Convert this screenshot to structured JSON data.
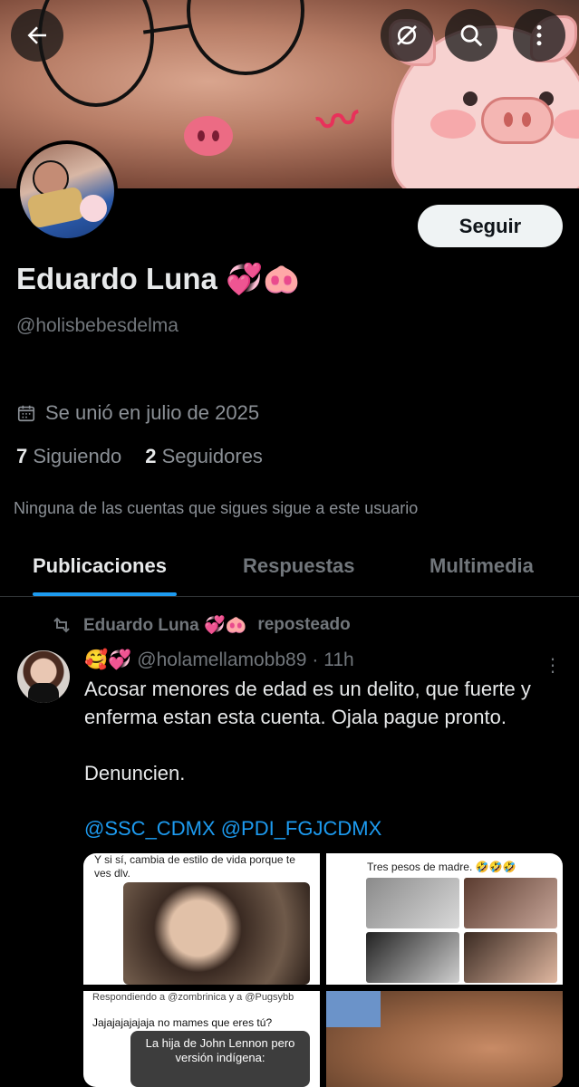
{
  "header": {
    "back_icon": "arrow-left-icon",
    "grok_icon": "grok-icon",
    "search_icon": "search-icon",
    "more_icon": "more-vertical-icon"
  },
  "profile": {
    "follow_label": "Seguir",
    "name": "Eduardo Luna 💞🐽",
    "handle": "@holisbebesdelma",
    "joined": "Se unió en julio de 2025",
    "following_count": "7",
    "following_label": "Siguiendo",
    "followers_count": "2",
    "followers_label": "Seguidores",
    "mutuals_notice": "Ninguna de las cuentas que sigues sigue a este usuario"
  },
  "tabs": [
    {
      "label": "Publicaciones",
      "active": true
    },
    {
      "label": "Respuestas",
      "active": false
    },
    {
      "label": "Multimedia",
      "active": false
    }
  ],
  "post": {
    "repost_by": "Eduardo Luna 💞🐽",
    "repost_label": "reposteado",
    "author_emojis": "🥰💞",
    "author_handle": "@holamellamobb89",
    "time": "· 11h",
    "text": "Acosar menores de edad es un delito, que fuerte y enferma estan esta cuenta. Ojala pague pronto.\n\nDenuncien.",
    "mentions": "@SSC_CDMX @PDI_FGJCDMX",
    "media": {
      "img1_caption": "Y si sí, cambia de estilo de vida porque te ves dlv.",
      "img2_caption": "Tres pesos de madre. 🤣🤣🤣",
      "img3_caption": "Respondiendo a @zombrinica y a @Pugsybb",
      "img3_text": "Jajajajajajaja no mames que eres tú?",
      "img3_meme": "La hija de John Lennon pero versión indígena:"
    }
  },
  "colors": {
    "accent": "#1d9bf0",
    "background": "#000000",
    "muted": "#71767b",
    "text": "#e7e9ea"
  }
}
